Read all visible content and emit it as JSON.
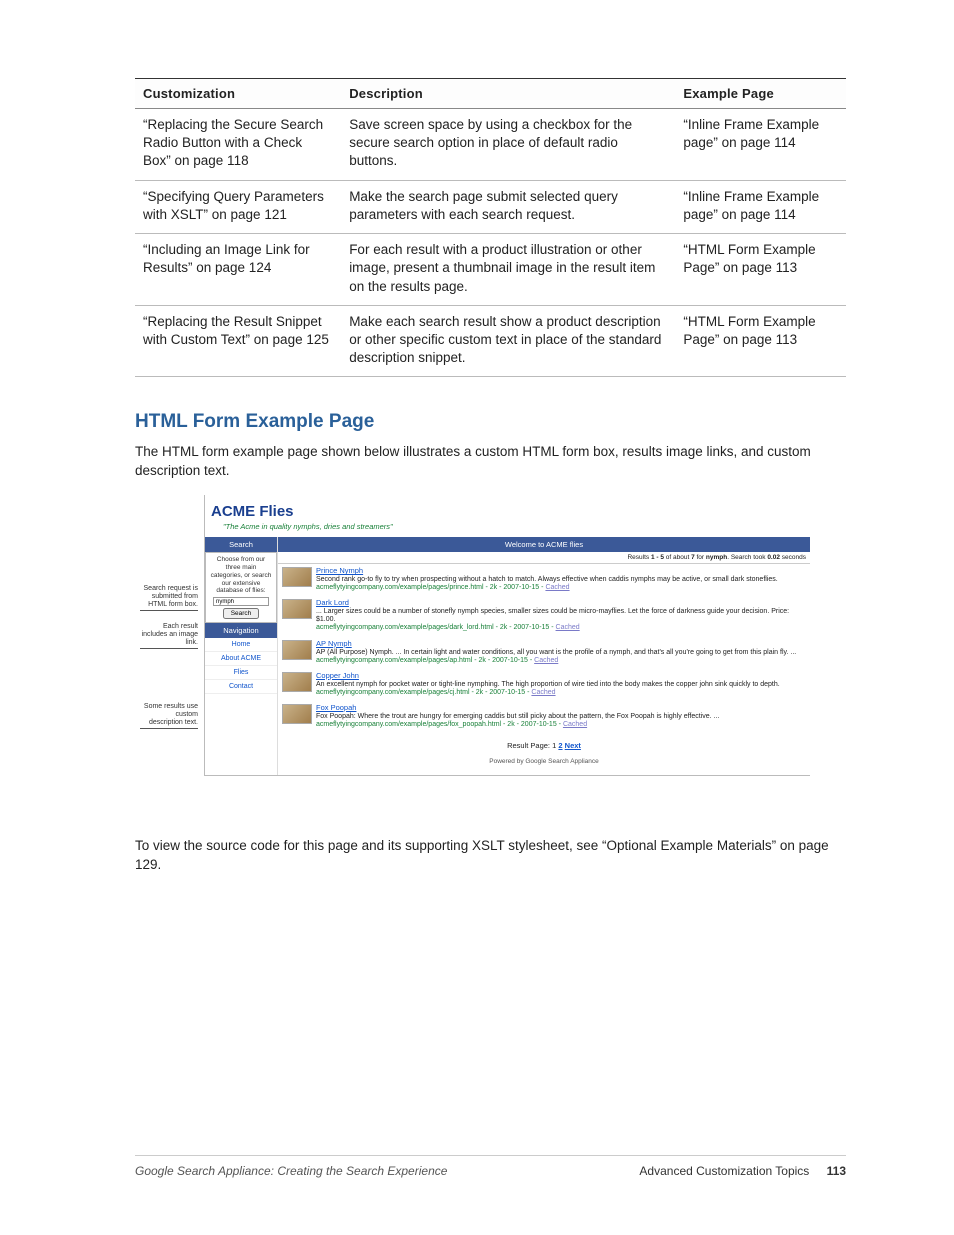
{
  "table": {
    "headers": {
      "c": "Customization",
      "d": "Description",
      "e": "Example Page"
    },
    "rows": [
      {
        "c": "“Replacing the Secure Search Radio Button with a Check Box” on page 118",
        "d": "Save screen space by using a checkbox for the secure search option in place of default radio buttons.",
        "e": "“Inline Frame Example page” on page 114"
      },
      {
        "c": "“Specifying Query Parameters with XSLT” on page 121",
        "d": "Make the search page submit selected query parameters with each search request.",
        "e": "“Inline Frame Example page” on page 114"
      },
      {
        "c": "“Including an Image Link for Results” on page 124",
        "d": "For each result with a product illustration or other image, present a thumbnail image in the result item on the results page.",
        "e": "“HTML Form Example Page” on page 113"
      },
      {
        "c": "“Replacing the Result Snippet with Custom Text” on page 125",
        "d": "Make each search result show a product description or other specific custom text in place of the standard description snippet.",
        "e": "“HTML Form Example Page” on page 113"
      }
    ]
  },
  "heading": "HTML Form Example Page",
  "intro": "The HTML form example page shown below illustrates a custom HTML form box, results image links, and custom description text.",
  "outro": "To view the source code for this page and its supporting XSLT stylesheet, see “Optional Example Materials” on page 129.",
  "figure": {
    "callouts": {
      "a": "Search request is submitted from HTML form box.",
      "b": "Each result includes an image link.",
      "c": "Some results use custom description text."
    },
    "title": "ACME Flies",
    "tagline": "\"The Acme in quality nymphs, dries and streamers\"",
    "sidebar": {
      "searchHdr": "Search",
      "helper": "Choose from our three main categories, or search our extensive database of flies:",
      "input": "nymph",
      "button": "Search",
      "navHdr": "Navigation",
      "links": [
        "Home",
        "About ACME",
        "Flies",
        "Contact"
      ]
    },
    "resultsHdr": "Welcome to ACME flies",
    "stats": {
      "range": "1 - 5",
      "about": "7",
      "q": "nymph",
      "secs": "0.02"
    },
    "items": [
      {
        "title": "Prince Nymph",
        "snip": "Second rank go-to fly to try when prospecting without a hatch to match. Always effective when caddis nymphs may be active, or small dark stoneflies.",
        "url": "acmeflytyingcompany.com/example/pages/prince.html - 2k - 2007-10-15 -"
      },
      {
        "title": "Dark Lord",
        "snip": "... Larger sizes could be a number of stonefly nymph species, smaller sizes could be micro-mayflies. Let the force of darkness guide your decision. Price: $1.00.",
        "url": "acmeflytyingcompany.com/example/pages/dark_lord.html - 2k - 2007-10-15 -"
      },
      {
        "title": "AP Nymph",
        "snip": "AP (All Purpose) Nymph. ... In certain light and water conditions, all you want is the profile of a nymph, and that's all you're going to get from this plain fly. ...",
        "url": "acmeflytyingcompany.com/example/pages/ap.html - 2k - 2007-10-15 -"
      },
      {
        "title": "Copper John",
        "snip": "An excellent nymph for pocket water or tight-line nymphing. The high proportion of wire tied into the body makes the copper john sink quickly to depth.",
        "url": "acmeflytyingcompany.com/example/pages/cj.html - 2k - 2007-10-15 -"
      },
      {
        "title": "Fox Poopah",
        "snip": "Fox Poopah: Where the trout are hungry for emerging caddis but still picky about the pattern, the Fox Poopah is highly effective. ...",
        "url": "acmeflytyingcompany.com/example/pages/fox_poopah.html - 2k - 2007-10-15 -"
      }
    ],
    "cached": "Cached",
    "pager": {
      "label": "Result Page:",
      "p1": "1",
      "p2": "2",
      "next": "Next"
    },
    "powered": "Powered by Google Search Appliance"
  },
  "footer": {
    "left": "Google Search Appliance: Creating the Search Experience",
    "right": "Advanced Customization Topics",
    "page": "113"
  }
}
